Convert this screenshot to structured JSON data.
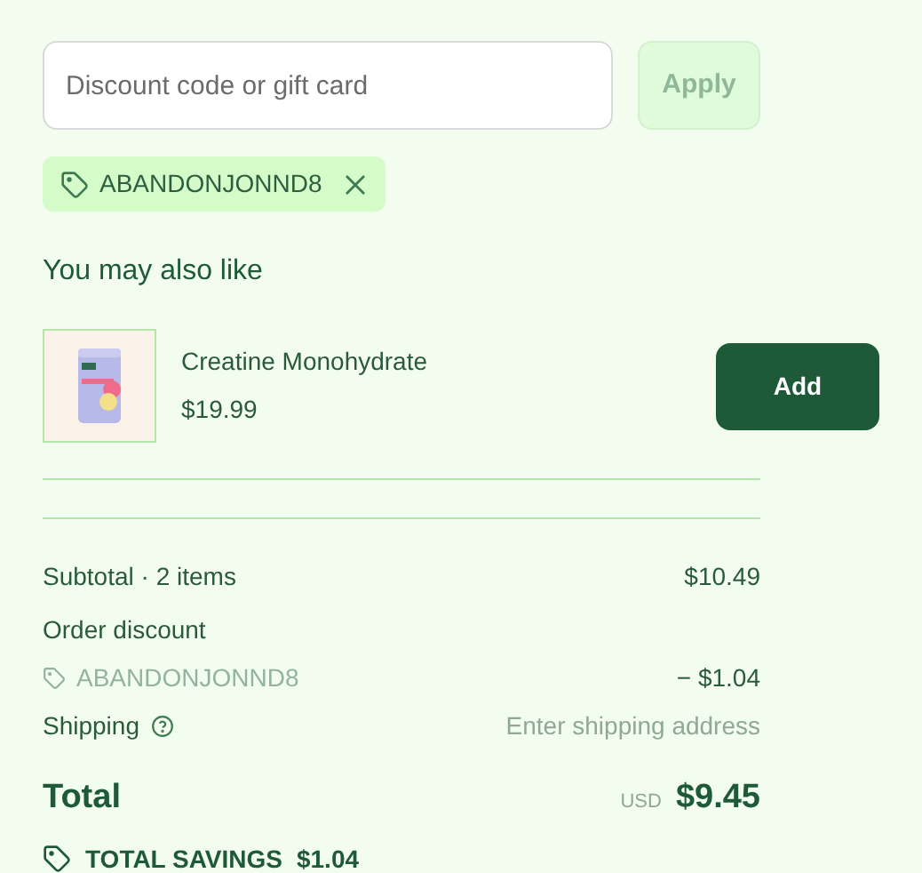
{
  "discount": {
    "placeholder": "Discount code or gift card",
    "apply_label": "Apply",
    "disabled": true
  },
  "applied_codes": [
    {
      "code": "ABANDONJONND8"
    }
  ],
  "recommendations": {
    "heading": "You may also like",
    "items": [
      {
        "name": "Creatine Monohydrate",
        "price": "$19.99",
        "button": "Add"
      }
    ]
  },
  "summary": {
    "subtotal_label": "Subtotal · 2 items",
    "subtotal": "$10.49",
    "discount_label": "Order discount",
    "discount_code": "ABANDONJONND8",
    "discount_value": "− $1.04",
    "shipping_label": "Shipping",
    "shipping_value": "Enter shipping address",
    "total_label": "Total",
    "currency": "USD",
    "total": "$9.45",
    "savings_label": "TOTAL SAVINGS",
    "savings_value": "$1.04"
  }
}
